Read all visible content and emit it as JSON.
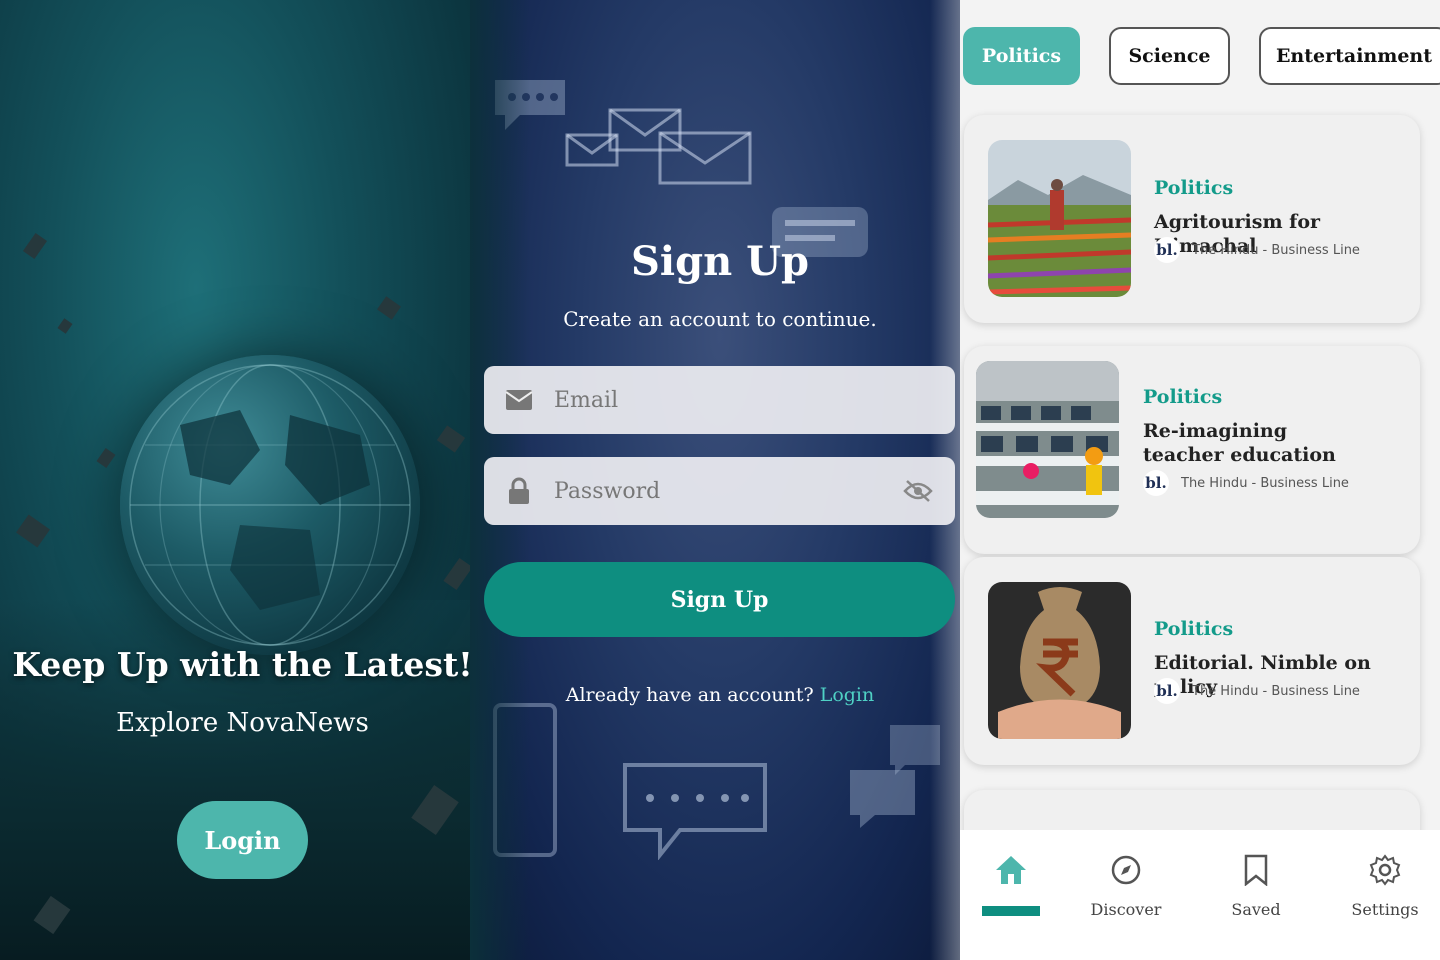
{
  "welcome": {
    "headline": "Keep Up with the Latest!",
    "subtitle": "Explore NovaNews",
    "login_label": "Login"
  },
  "signup": {
    "title": "Sign Up",
    "subtitle": "Create an account to continue.",
    "email_placeholder": "Email",
    "password_placeholder": "Password",
    "button_label": "Sign Up",
    "already_text": "Already have an account?",
    "login_link": "Login"
  },
  "feed": {
    "chips": [
      {
        "label": "Politics",
        "active": true
      },
      {
        "label": "Science",
        "active": false
      },
      {
        "label": "Entertainment",
        "active": false
      }
    ],
    "articles": [
      {
        "category": "Politics",
        "title": "Agritourism for Himachal",
        "source_logo": "bl.",
        "source": "The Hindu - Business Line"
      },
      {
        "category": "Politics",
        "title": "Re-imagining teacher education",
        "source_logo": "bl.",
        "source": "The Hindu - Business Line"
      },
      {
        "category": "Politics",
        "title": "Editorial. Nimble on policy",
        "source_logo": "bl.",
        "source": "The Hindu - Business Line"
      }
    ],
    "nav": [
      {
        "label": "",
        "icon": "home-icon",
        "active": true
      },
      {
        "label": "Discover",
        "icon": "compass-icon",
        "active": false
      },
      {
        "label": "Saved",
        "icon": "bookmark-icon",
        "active": false
      },
      {
        "label": "Settings",
        "icon": "gear-icon",
        "active": false
      }
    ]
  },
  "colors": {
    "accent": "#4db6ac",
    "primary_button": "#0e8e80",
    "category_text": "#139b8a"
  }
}
